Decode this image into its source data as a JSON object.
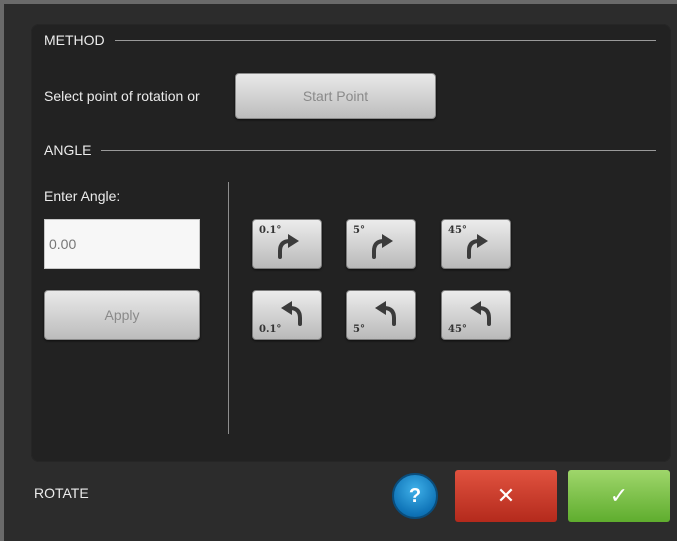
{
  "method": {
    "heading": "METHOD",
    "prompt": "Select point of rotation or",
    "start_point_label": "Start Point"
  },
  "angle": {
    "heading": "ANGLE",
    "enter_label": "Enter Angle:",
    "value": "0.00",
    "apply_label": "Apply",
    "clockwise": [
      {
        "label": "0.1°",
        "icon": "rotate-cw-icon"
      },
      {
        "label": "5°",
        "icon": "rotate-cw-icon"
      },
      {
        "label": "45°",
        "icon": "rotate-cw-icon"
      }
    ],
    "counterclockwise": [
      {
        "label": "0.1°",
        "icon": "rotate-ccw-icon"
      },
      {
        "label": "5°",
        "icon": "rotate-ccw-icon"
      },
      {
        "label": "45°",
        "icon": "rotate-ccw-icon"
      }
    ]
  },
  "footer": {
    "title": "ROTATE",
    "help_label": "?",
    "cancel_label": "✕",
    "ok_label": "✓"
  },
  "colors": {
    "help": "#1487cc",
    "cancel": "#c9382a",
    "ok": "#7fc24a"
  }
}
